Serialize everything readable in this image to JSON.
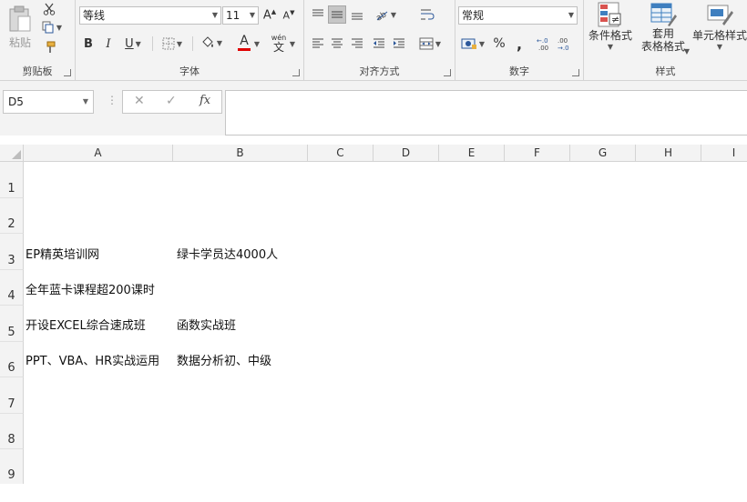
{
  "ribbon": {
    "clipboard": {
      "label": "剪贴板",
      "paste_label": "粘贴"
    },
    "font": {
      "label": "字体",
      "font_name": "等线",
      "font_size": "11",
      "bold": "B",
      "italic": "I",
      "underline": "U",
      "wen_label": "wén",
      "wen_char": "文"
    },
    "alignment": {
      "label": "对齐方式"
    },
    "number": {
      "label": "数字",
      "format": "常规",
      "percent": "%",
      "comma": ","
    },
    "styles": {
      "label": "样式",
      "conditional": "条件格式",
      "table_line1": "套用",
      "table_line2": "表格格式",
      "cell_styles": "单元格样式"
    }
  },
  "formula_bar": {
    "name_box": "D5",
    "fx": "fx",
    "cancel": "✕",
    "enter": "✓"
  },
  "columns": [
    "A",
    "B",
    "C",
    "D",
    "E",
    "F",
    "G",
    "H",
    "I"
  ],
  "rows": [
    "1",
    "2",
    "3",
    "4",
    "5",
    "6",
    "7",
    "8",
    "9"
  ],
  "cells": {
    "A3": "EP精英培训网",
    "B3": "绿卡学员达4000人",
    "A4": "全年蓝卡课程超200课时",
    "A5": "开设EXCEL综合速成班",
    "B5": "函数实战班",
    "A6": "PPT、VBA、HR实战运用",
    "B6": "数据分析初、中级"
  },
  "colors": {
    "font_color_bar": "#e00000",
    "ribbon_bg": "#f3f3f3",
    "border": "#d4d4d4"
  }
}
